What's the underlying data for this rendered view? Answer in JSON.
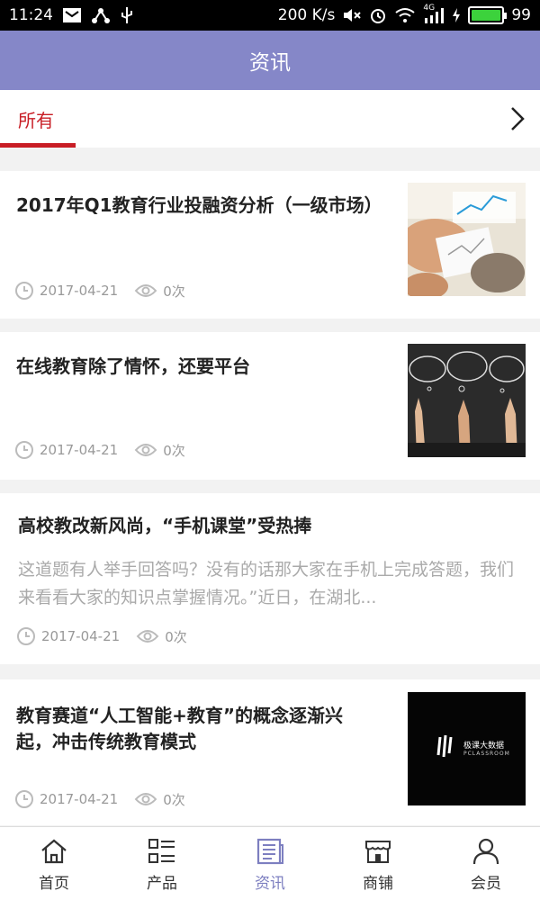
{
  "status_bar": {
    "time": "11:24",
    "net_speed": "200 K/s",
    "network": "4G",
    "battery": "99",
    "battery_level": 0.99
  },
  "header": {
    "title": "资讯"
  },
  "category_bar": {
    "active_tab": "所有"
  },
  "articles": [
    {
      "title": "2017年Q1教育行业投融资分析（一级市场）",
      "date": "2017-04-21",
      "views": "0次",
      "thumbnail": "business-meeting-charts"
    },
    {
      "title": "在线教育除了情怀，还要平台",
      "date": "2017-04-21",
      "views": "0次",
      "thumbnail": "chalkboard-hands"
    },
    {
      "title": "高校教改新风尚，“手机课堂”受热捧",
      "summary": "这道题有人举手回答吗？没有的话那大家在手机上完成答题，我们来看看大家的知识点掌握情况。”近日，在湖北...",
      "date": "2017-04-21",
      "views": "0次"
    },
    {
      "title": "教育赛道“人工智能+教育”的概念逐渐兴起，冲击传统教育模式",
      "date": "2017-04-21",
      "views": "0次",
      "thumbnail": "pclassroom-logo",
      "thumb_brand": "极课大数据",
      "thumb_brand_en": "PCLASSROOM"
    }
  ],
  "bottom_nav": [
    {
      "label": "首页",
      "icon": "home-icon"
    },
    {
      "label": "产品",
      "icon": "list-icon"
    },
    {
      "label": "资讯",
      "icon": "news-icon",
      "active": true
    },
    {
      "label": "商铺",
      "icon": "shop-icon"
    },
    {
      "label": "会员",
      "icon": "user-icon"
    }
  ],
  "colors": {
    "header_bg": "#8587c8",
    "accent_red": "#c81d25",
    "active_nav": "#7d7fc0"
  }
}
